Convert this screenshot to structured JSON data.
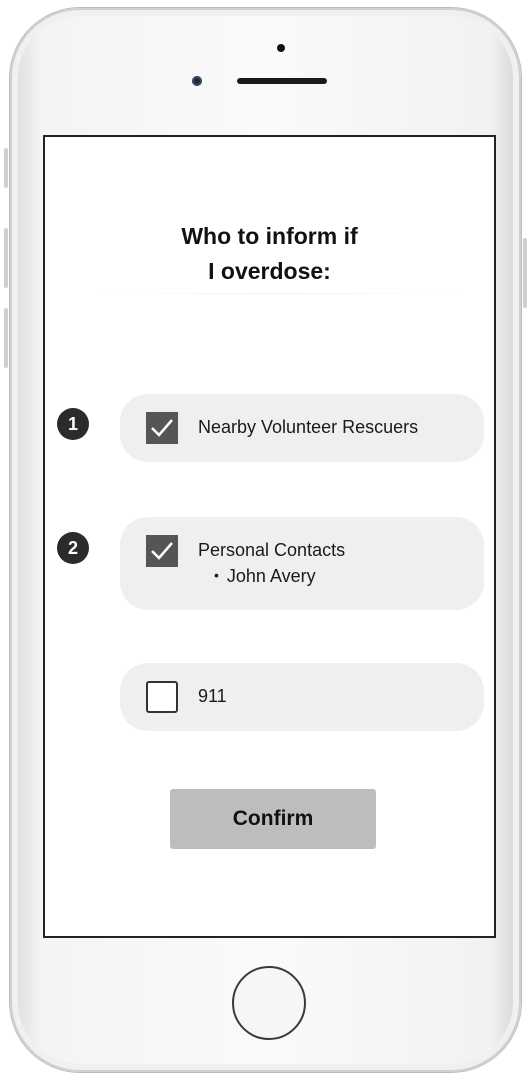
{
  "screen": {
    "title_line1": "Who to inform if",
    "title_line2": "I overdose:"
  },
  "steps": [
    {
      "number": "1"
    },
    {
      "number": "2"
    }
  ],
  "options": [
    {
      "label": "Nearby Volunteer Rescuers",
      "checked": true
    },
    {
      "label": "Personal Contacts",
      "checked": true,
      "sub_items": [
        "John Avery"
      ]
    },
    {
      "label": "911",
      "checked": false
    }
  ],
  "confirm_button": {
    "label": "Confirm"
  },
  "icons": {
    "checkmark": "check-icon",
    "bullet": "•"
  }
}
